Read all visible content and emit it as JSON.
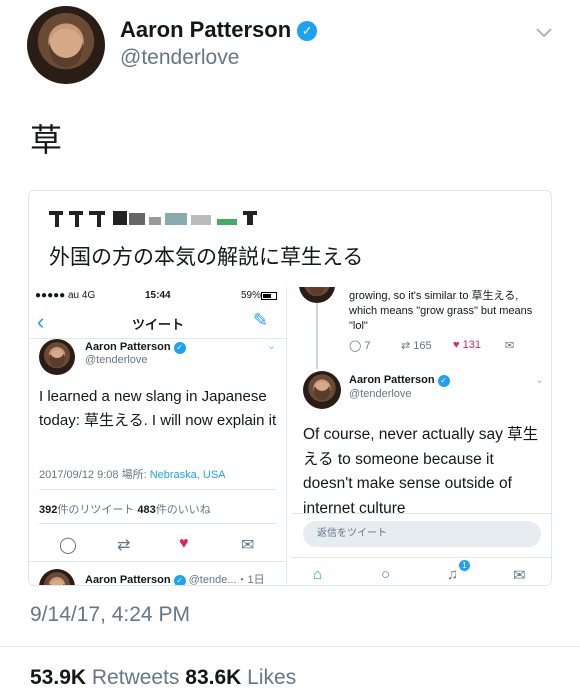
{
  "tweet": {
    "author_name": "Aaron Patterson",
    "author_handle": "@tenderlove",
    "text": "草",
    "timestamp": "9/14/17, 4:24 PM",
    "retweets_count": "53.9K",
    "retweets_label": "Retweets",
    "likes_count": "83.6K",
    "likes_label": "Likes"
  },
  "quoted": {
    "caption": "外国の方の本気の解説に草生える",
    "left": {
      "status": {
        "carrier": "●●●●● au  4G",
        "time": "15:44",
        "battery": "59%"
      },
      "nav_title": "ツイート",
      "author_name": "Aaron Patterson",
      "author_handle": "@tenderlove",
      "text": "I learned a new slang in Japanese today: 草生える. I will now explain it",
      "date": "2017/09/12 9:08 場所: ",
      "location": "Nebraska, USA",
      "retweets_num": "392",
      "retweets_label": "件のリツイート",
      "likes_num": "483",
      "likes_label": "件のいいね",
      "next_name": "Aaron Patterson",
      "next_handle": "@tende...・1日"
    },
    "right": {
      "prev_text": "growing, so it's similar to 草生える, which means \"grow grass\" but means \"lol\"",
      "reply_count": "7",
      "retweet_count": "165",
      "like_count": "131",
      "author_name": "Aaron Patterson",
      "author_handle": "@tenderlove",
      "text": "Of course, never actually say 草生える to someone because it doesn't make sense outside of internet culture",
      "reply_placeholder": "返信をツイート",
      "notif_badge": "1"
    }
  }
}
